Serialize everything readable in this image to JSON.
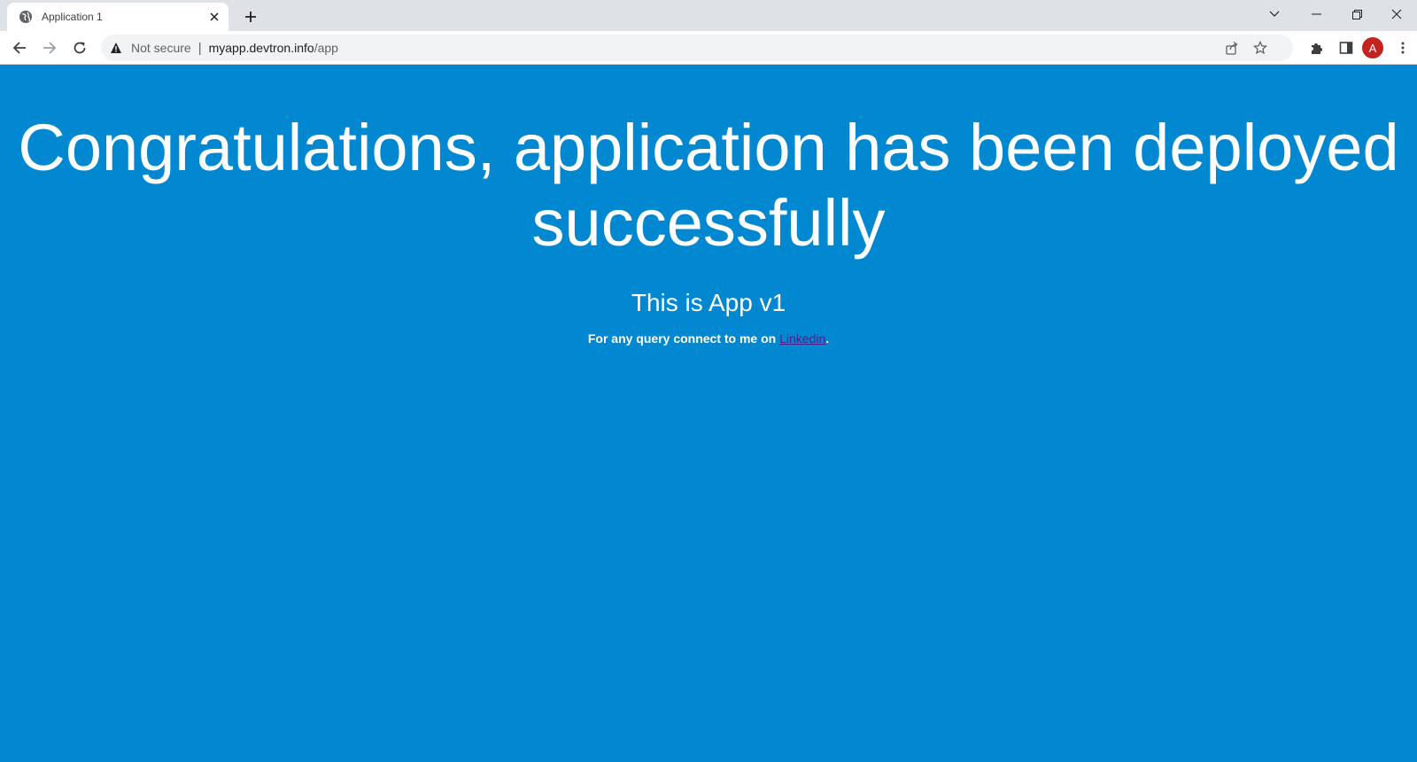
{
  "browser": {
    "tab_title": "Application 1",
    "security_label": "Not secure",
    "url_host": "myapp.devtron.info",
    "url_path": "/app",
    "avatar_letter": "A"
  },
  "page": {
    "background_color": "#0288d1",
    "headline": "Congratulations, application has been deployed successfully",
    "subhead": "This is App v1",
    "contact_text": "For any query connect to me on ",
    "contact_link": "Linkedin",
    "contact_suffix": "."
  },
  "icons": {
    "favicon": "globe-icon",
    "tab_close": "close-icon",
    "new_tab": "plus-icon",
    "tab_search": "chevron-down-icon",
    "minimize": "minimize-icon",
    "restore": "restore-icon",
    "close_window": "close-icon",
    "back": "arrow-left-icon",
    "forward": "arrow-right-icon",
    "reload": "reload-icon",
    "security": "warning-icon",
    "share": "share-icon",
    "bookmark": "star-icon",
    "extensions": "puzzle-icon",
    "side_panel": "side-panel-icon",
    "menu": "kebab-menu-icon"
  }
}
